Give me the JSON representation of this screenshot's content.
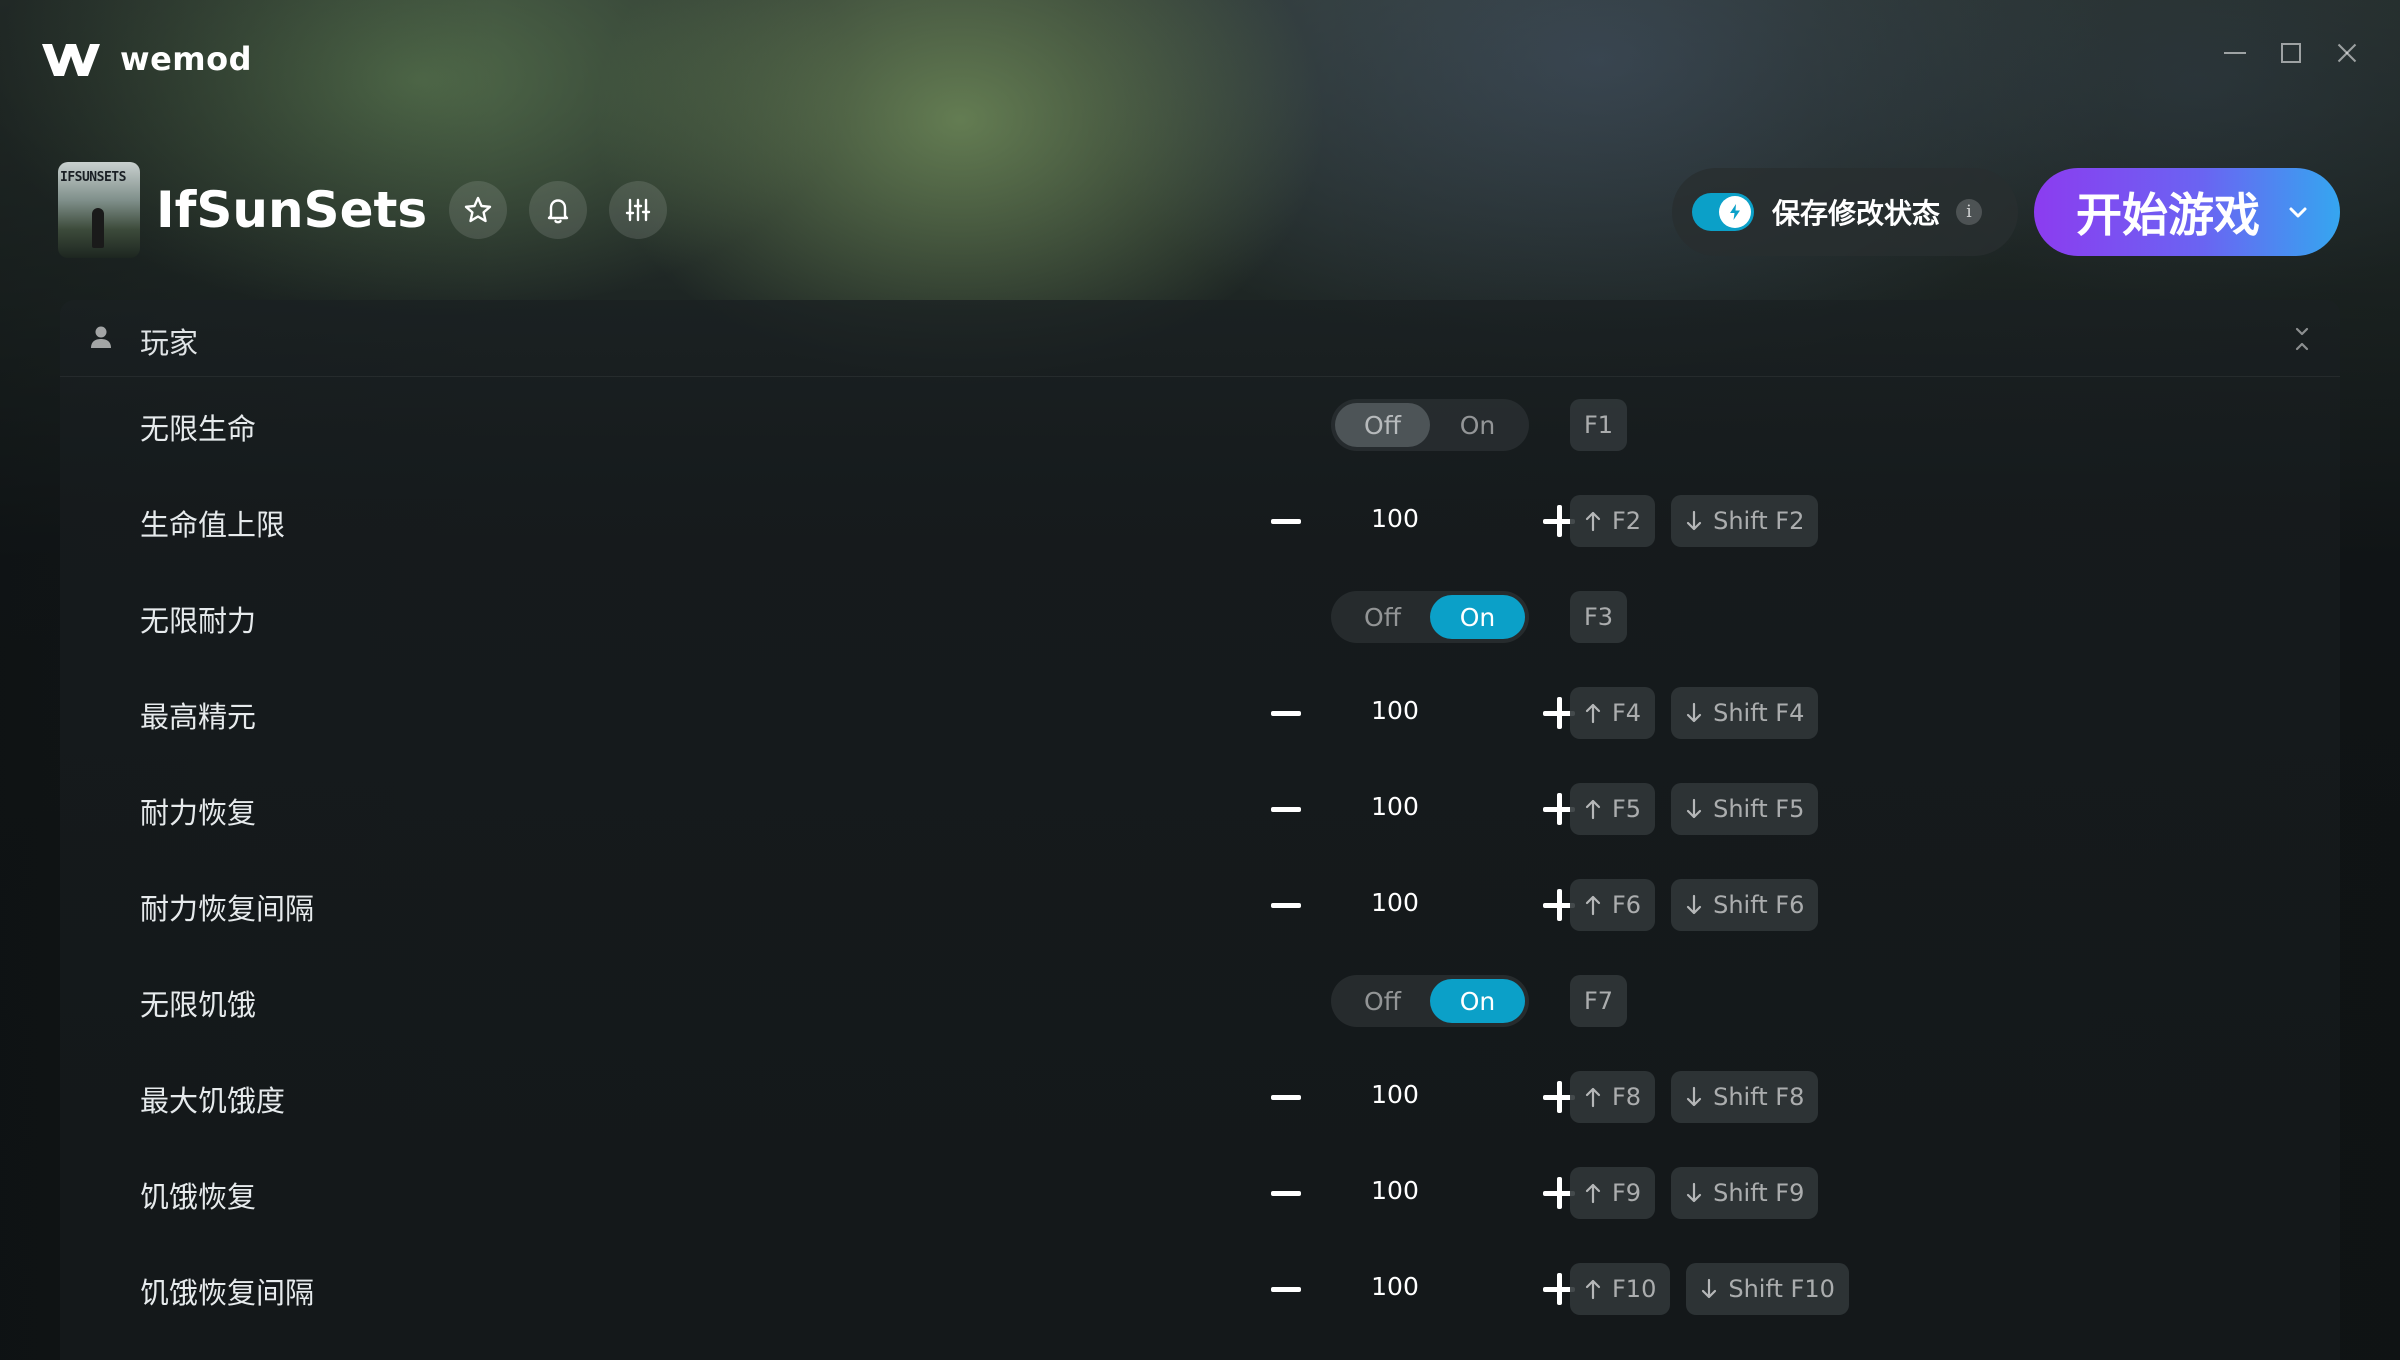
{
  "app": {
    "logo_text": "wemod"
  },
  "game": {
    "title": "IfSunSets",
    "cover_text": "IFSUNSETS"
  },
  "header": {
    "save_mods_label": "保存修改状态",
    "info_label": "i",
    "play_label": "开始游戏",
    "save_mods_enabled": true
  },
  "section": {
    "title": "玩家"
  },
  "mods": [
    {
      "label": "无限生命",
      "type": "toggle",
      "off_label": "Off",
      "on_label": "On",
      "state": "Off",
      "keys": [
        "F1"
      ]
    },
    {
      "label": "生命值上限",
      "type": "stepper",
      "value": "100",
      "inc_key": "F2",
      "dec_key": "Shift F2"
    },
    {
      "label": "无限耐力",
      "type": "toggle",
      "off_label": "Off",
      "on_label": "On",
      "state": "On",
      "keys": [
        "F3"
      ]
    },
    {
      "label": "最高精元",
      "type": "stepper",
      "value": "100",
      "inc_key": "F4",
      "dec_key": "Shift F4"
    },
    {
      "label": "耐力恢复",
      "type": "stepper",
      "value": "100",
      "inc_key": "F5",
      "dec_key": "Shift F5"
    },
    {
      "label": "耐力恢复间隔",
      "type": "stepper",
      "value": "100",
      "inc_key": "F6",
      "dec_key": "Shift F6"
    },
    {
      "label": "无限饥饿",
      "type": "toggle",
      "off_label": "Off",
      "on_label": "On",
      "state": "On",
      "keys": [
        "F7"
      ]
    },
    {
      "label": "最大饥饿度",
      "type": "stepper",
      "value": "100",
      "inc_key": "F8",
      "dec_key": "Shift F8"
    },
    {
      "label": "饥饿恢复",
      "type": "stepper",
      "value": "100",
      "inc_key": "F9",
      "dec_key": "Shift F9"
    },
    {
      "label": "饥饿恢复间隔",
      "type": "stepper",
      "value": "100",
      "inc_key": "F10",
      "dec_key": "Shift F10"
    }
  ],
  "colors": {
    "accent_on": "#0ba0c8",
    "play_gradient_start": "#8c3cf0",
    "play_gradient_end": "#35a6f0"
  }
}
